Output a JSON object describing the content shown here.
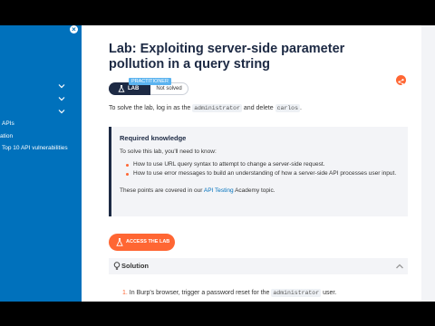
{
  "sidebar": {
    "close_icon": "close-icon",
    "items": [
      {
        "label": "APIs"
      },
      {
        "label": "ation"
      },
      {
        "label": "Top 10 API vulnerabilities"
      }
    ],
    "chevron_count": 3
  },
  "lab": {
    "title": "Lab: Exploiting server-side parameter pollution in a query string",
    "level": "PRACTITIONER",
    "badge_label": "LAB",
    "status": "Not solved",
    "intro": {
      "before": "To solve the lab, log in as the",
      "user": "administrator",
      "middle": "and delete",
      "target": "carlos",
      "after": "."
    }
  },
  "knowledge": {
    "title": "Required knowledge",
    "lead": "To solve this lab, you'll need to know:",
    "items": [
      "How to use URL query syntax to attempt to change a server-side request.",
      "How to use error messages to build an understanding of how a server-side API processes user input."
    ],
    "foot_before": "These points are covered in our",
    "foot_link": "API Testing",
    "foot_after": "Academy topic."
  },
  "access_button": {
    "label": "ACCESS THE LAB"
  },
  "solution": {
    "label": "Solution",
    "step1": {
      "num": "1.",
      "before": "In Burp's browser, trigger a password reset for the",
      "code": "administrator",
      "after": "user."
    }
  },
  "colors": {
    "sidebar": "#0071bc",
    "accent": "#ff6633",
    "title": "#1d2a44",
    "level_tag": "#5bb3ef"
  }
}
